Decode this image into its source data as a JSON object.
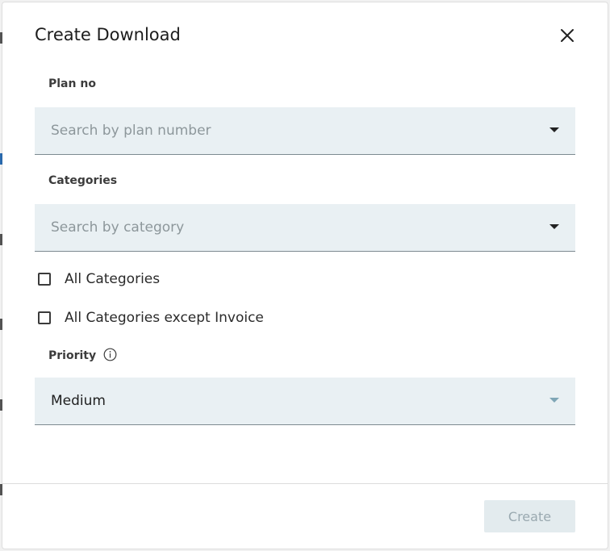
{
  "dialog": {
    "title": "Create Download",
    "close_icon": "close-icon"
  },
  "plan_no": {
    "label": "Plan no",
    "placeholder": "Search by plan number",
    "caret_icon": "caret-down-icon"
  },
  "categories": {
    "label": "Categories",
    "placeholder": "Search by category",
    "caret_icon": "caret-down-icon"
  },
  "checkboxes": [
    {
      "label": "All Categories",
      "checked": false
    },
    {
      "label": "All Categories except Invoice",
      "checked": false
    }
  ],
  "priority": {
    "label": "Priority",
    "info_icon": "info-icon",
    "value": "Medium",
    "caret_icon": "caret-down-icon"
  },
  "footer": {
    "create_label": "Create",
    "create_enabled": false
  },
  "colors": {
    "field_bg": "#e9f0f3",
    "disabled_button_bg": "#e3ebee",
    "disabled_button_text": "#9aa9b0"
  }
}
